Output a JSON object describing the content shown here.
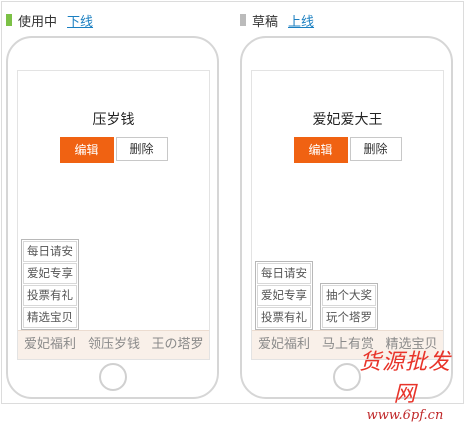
{
  "active": {
    "status_label": "使用中",
    "status_color": "#7cc146",
    "action_link": "下线",
    "account_name": "压岁钱",
    "edit_label": "编辑",
    "delete_label": "删除",
    "menu": [
      "爱妃福利",
      "领压岁钱",
      "王の塔罗"
    ],
    "submenu": [
      "每日请安",
      "爱妃专享",
      "投票有礼",
      "精选宝贝"
    ]
  },
  "draft": {
    "status_label": "草稿",
    "status_color": "#bbbbbb",
    "action_link": "上线",
    "account_name": "爱妃爱大王",
    "edit_label": "编辑",
    "delete_label": "删除",
    "menu": [
      "爱妃福利",
      "马上有赏",
      "精选宝贝"
    ],
    "submenu_1": [
      "每日请安",
      "爱妃专享",
      "投票有礼"
    ],
    "submenu_2": [
      "抽个大奖",
      "玩个塔罗"
    ]
  },
  "watermark": {
    "text": "货源批发网",
    "url": "www.6pf.cn"
  },
  "colors": {
    "accent": "#f06212",
    "link": "#1a7fc1",
    "menu_bg": "#f9f0e9"
  }
}
